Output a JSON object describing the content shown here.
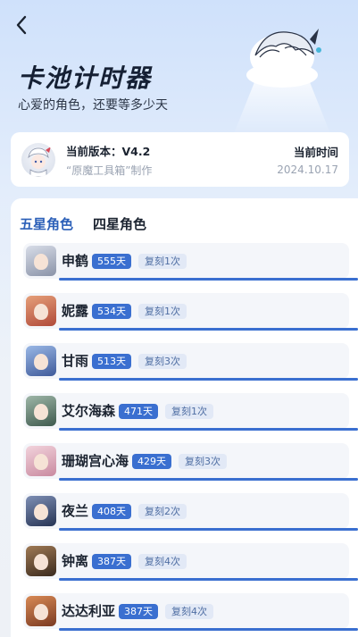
{
  "header": {
    "back_icon": "chevron-left-icon",
    "title": "卡池计时器",
    "subtitle": "心爱的角色，还要等多少天"
  },
  "info": {
    "version_label": "当前版本：V4.2",
    "maker_label": "“原魔工具箱”制作",
    "time_label": "当前时间",
    "time_value": "2024.10.17"
  },
  "tabs": [
    {
      "label": "五星角色",
      "active": true
    },
    {
      "label": "四星角色",
      "active": false
    }
  ],
  "colors": {
    "accent": "#3a6fd0",
    "active_tab": "#2b5fb8",
    "rerun_bg": "#e2e9f6"
  },
  "characters": [
    {
      "name": "申鹤",
      "days": "555天",
      "reruns": "复刻1次",
      "progress": 1.0,
      "avatar_colors": [
        "#d8dde8",
        "#8a93a8"
      ]
    },
    {
      "name": "妮露",
      "days": "534天",
      "reruns": "复刻1次",
      "progress": 1.0,
      "avatar_colors": [
        "#e6a07a",
        "#b04a3a"
      ]
    },
    {
      "name": "甘雨",
      "days": "513天",
      "reruns": "复刻3次",
      "progress": 1.0,
      "avatar_colors": [
        "#9ab8e6",
        "#3f5a9a"
      ]
    },
    {
      "name": "艾尔海森",
      "days": "471天",
      "reruns": "复刻1次",
      "progress": 1.0,
      "avatar_colors": [
        "#9fb7a8",
        "#3e5a4e"
      ]
    },
    {
      "name": "珊瑚宫心海",
      "days": "429天",
      "reruns": "复刻3次",
      "progress": 1.0,
      "avatar_colors": [
        "#f2d3dc",
        "#c98aa0"
      ]
    },
    {
      "name": "夜兰",
      "days": "408天",
      "reruns": "复刻2次",
      "progress": 1.0,
      "avatar_colors": [
        "#7e8fb5",
        "#263455"
      ]
    },
    {
      "name": "钟离",
      "days": "387天",
      "reruns": "复刻4次",
      "progress": 1.0,
      "avatar_colors": [
        "#a07a55",
        "#3a2a1e"
      ]
    },
    {
      "name": "达达利亚",
      "days": "387天",
      "reruns": "复刻4次",
      "progress": 1.0,
      "avatar_colors": [
        "#d98a55",
        "#7a3a22"
      ]
    }
  ]
}
